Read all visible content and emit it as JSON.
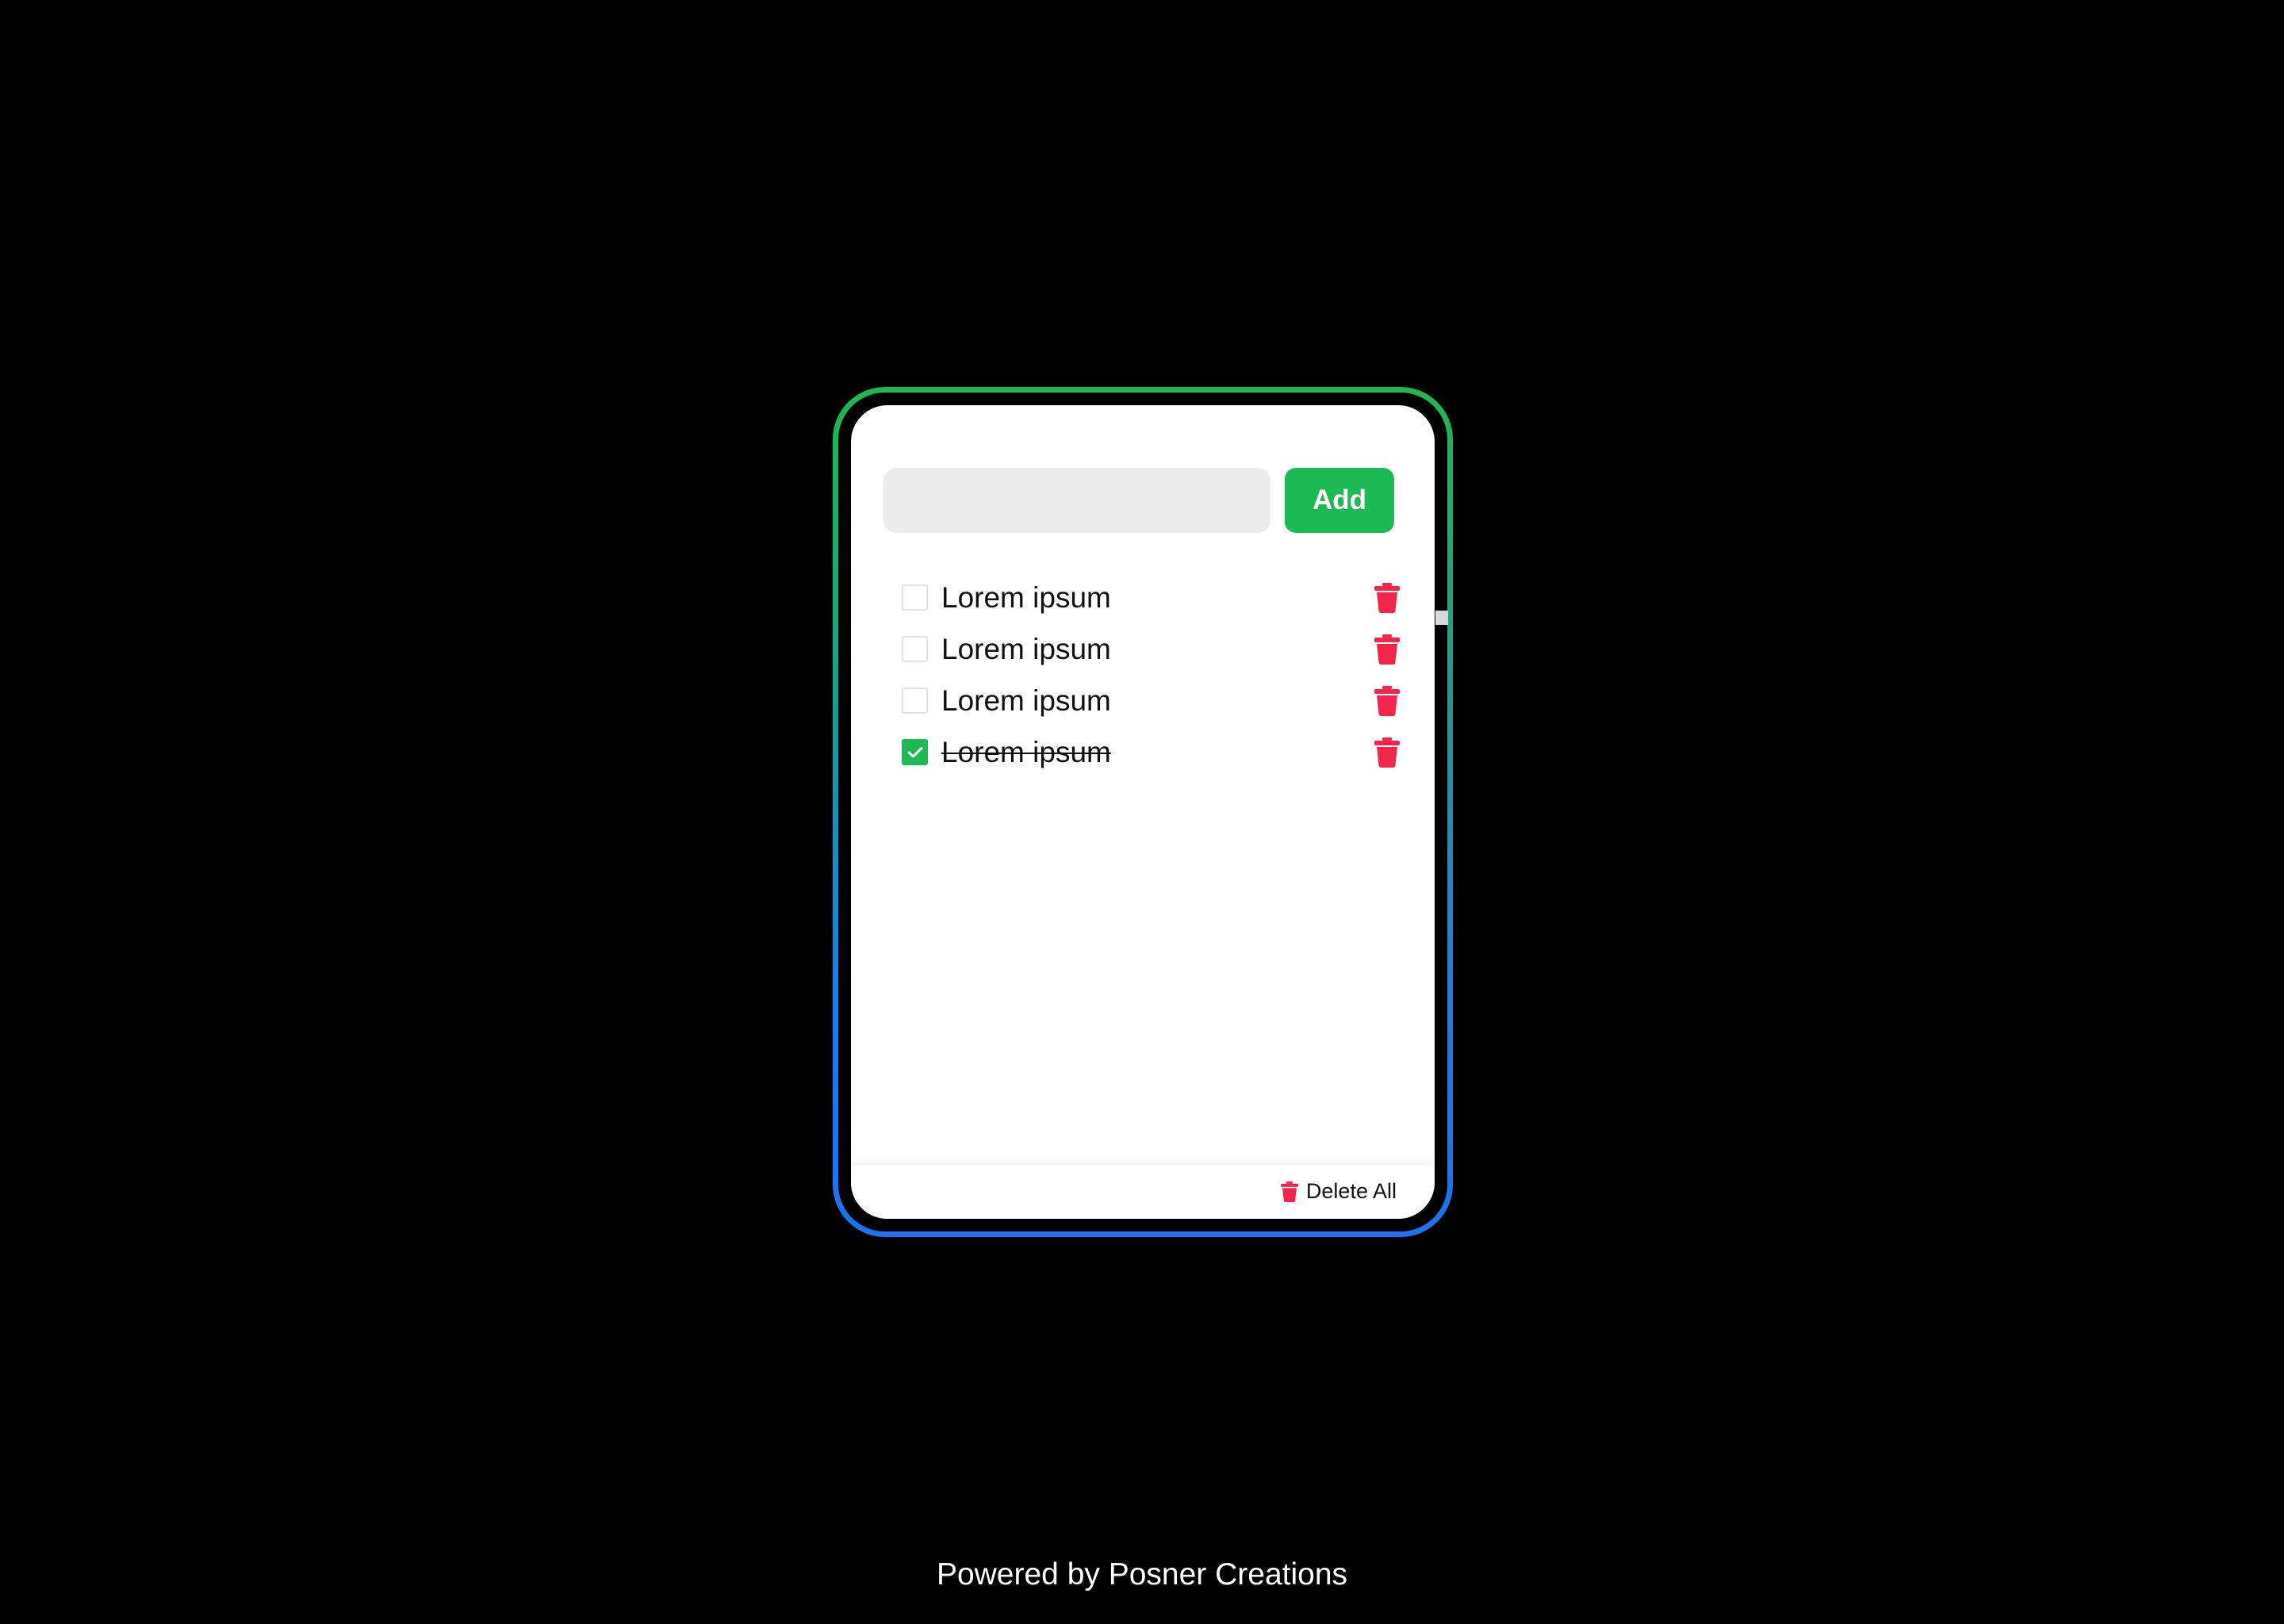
{
  "input": {
    "value": "",
    "placeholder": ""
  },
  "add_button": {
    "label": "Add"
  },
  "items": [
    {
      "label": "Lorem ipsum",
      "checked": false
    },
    {
      "label": "Lorem ipsum",
      "checked": false
    },
    {
      "label": "Lorem ipsum",
      "checked": false
    },
    {
      "label": "Lorem ipsum",
      "checked": true
    }
  ],
  "icons": {
    "item_delete": "trash-icon",
    "checked": "check-icon",
    "delete_all": "trash-icon"
  },
  "footer": {
    "delete_all_label": "Delete All"
  },
  "credit": {
    "text": "Powered by Posner Creations"
  },
  "colors": {
    "accent_green": "#1db954",
    "danger_red": "#f2254b",
    "frame_gradient_top": "#1fb84f",
    "frame_gradient_bottom": "#1c72f0",
    "background": "#000000",
    "input_bg": "#ececec"
  }
}
